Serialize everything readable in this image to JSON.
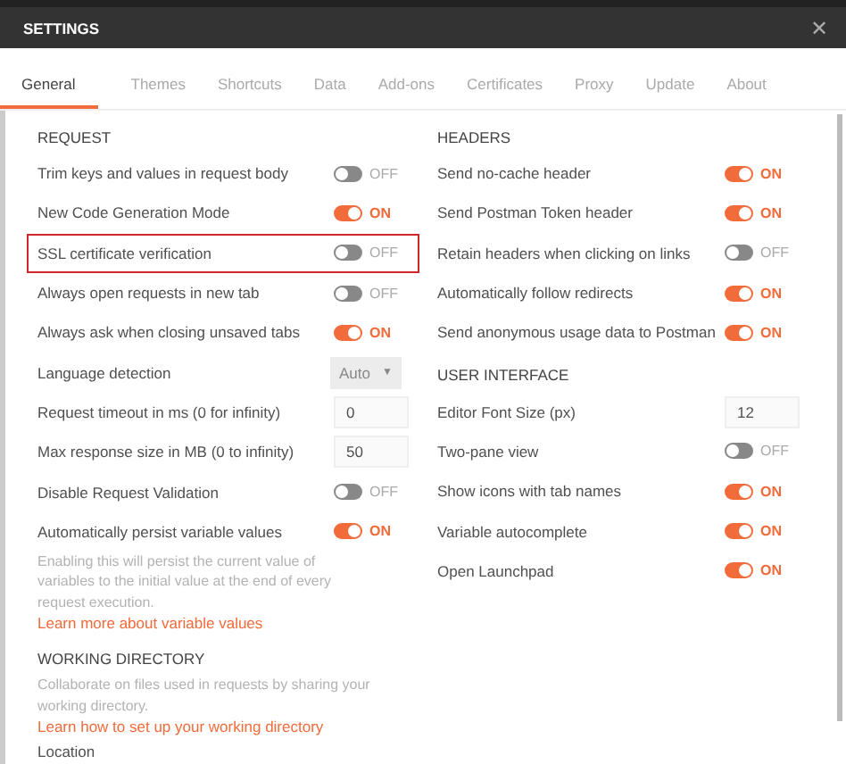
{
  "window": {
    "title": "SETTINGS",
    "close": "✕"
  },
  "tabs": [
    {
      "label": "General",
      "selected": true
    },
    {
      "label": "Themes",
      "selected": false
    },
    {
      "label": "Shortcuts",
      "selected": false
    },
    {
      "label": "Data",
      "selected": false
    },
    {
      "label": "Add-ons",
      "selected": false
    },
    {
      "label": "Certificates",
      "selected": false
    },
    {
      "label": "Proxy",
      "selected": false
    },
    {
      "label": "Update",
      "selected": false
    },
    {
      "label": "About",
      "selected": false
    }
  ],
  "left": [
    {
      "heading": "REQUEST",
      "rows": [
        {
          "kind": "toggle",
          "label": "Trim keys and values in request body",
          "on": false,
          "state": "OFF",
          "highlighted": false
        },
        {
          "kind": "toggle",
          "label": "New Code Generation Mode",
          "on": true,
          "state": "ON",
          "highlighted": false
        },
        {
          "kind": "toggle",
          "label": "SSL certificate verification",
          "on": false,
          "state": "OFF",
          "highlighted": true
        },
        {
          "kind": "toggle",
          "label": "Always open requests in new tab",
          "on": false,
          "state": "OFF",
          "highlighted": false
        },
        {
          "kind": "toggle",
          "label": "Always ask when closing unsaved tabs",
          "on": true,
          "state": "ON",
          "highlighted": false
        },
        {
          "kind": "select",
          "label": "Language detection",
          "value": "Auto",
          "caret": "▼",
          "highlighted": false
        },
        {
          "kind": "input",
          "label": "Request timeout in ms (0 for infinity)",
          "value": "0",
          "highlighted": false
        },
        {
          "kind": "input",
          "label": "Max response size in MB (0 to infinity)",
          "value": "50",
          "highlighted": false
        },
        {
          "kind": "toggle",
          "label": "Disable Request Validation",
          "on": false,
          "state": "OFF",
          "highlighted": false
        },
        {
          "kind": "toggle",
          "label": "Automatically persist variable values",
          "on": true,
          "state": "ON",
          "highlighted": false,
          "description": "Enabling this will persist the current value of variables to the initial value at the end of every request execution.",
          "link": "Learn more about variable values"
        }
      ]
    },
    {
      "heading": "WORKING DIRECTORY",
      "description": "Collaborate on files used in requests by sharing your working directory.",
      "link": "Learn how to set up your working directory",
      "footer": "Location"
    }
  ],
  "right": [
    {
      "heading": "HEADERS",
      "rows": [
        {
          "kind": "toggle",
          "label": "Send no-cache header",
          "on": true,
          "state": "ON"
        },
        {
          "kind": "toggle",
          "label": "Send Postman Token header",
          "on": true,
          "state": "ON"
        },
        {
          "kind": "toggle",
          "label": "Retain headers when clicking on links",
          "on": false,
          "state": "OFF"
        },
        {
          "kind": "toggle",
          "label": "Automatically follow redirects",
          "on": true,
          "state": "ON"
        },
        {
          "kind": "toggle",
          "label": "Send anonymous usage data to Postman",
          "on": true,
          "state": "ON"
        }
      ]
    },
    {
      "heading": "USER INTERFACE",
      "rows": [
        {
          "kind": "input",
          "label": "Editor Font Size (px)",
          "value": "12"
        },
        {
          "kind": "toggle",
          "label": "Two-pane view",
          "on": false,
          "state": "OFF"
        },
        {
          "kind": "toggle",
          "label": "Show icons with tab names",
          "on": true,
          "state": "ON"
        },
        {
          "kind": "toggle",
          "label": "Variable autocomplete",
          "on": true,
          "state": "ON"
        },
        {
          "kind": "toggle",
          "label": "Open Launchpad",
          "on": true,
          "state": "ON"
        }
      ]
    }
  ]
}
